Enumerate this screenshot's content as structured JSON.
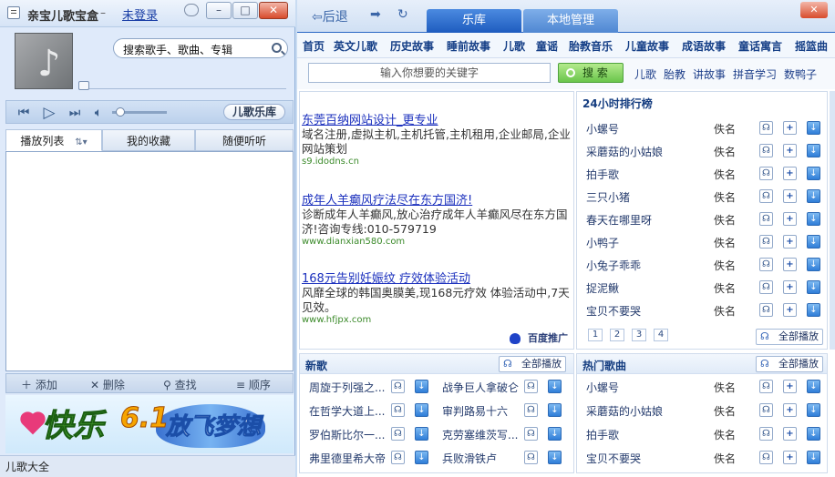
{
  "player": {
    "app_title": "亲宝儿歌宝盒",
    "title_sep": "–",
    "login_link": "未登录",
    "search_placeholder": "搜索歌手、歌曲、专辑",
    "library_button": "儿歌乐库",
    "tabs": [
      "播放列表",
      "我的收藏",
      "随便听听"
    ],
    "toolbar": [
      "添加",
      "删除",
      "查找",
      "顺序"
    ],
    "banner": {
      "text1": "快乐",
      "text2": "6.1",
      "text3": "放飞梦想"
    },
    "status": "儿歌大全"
  },
  "browser": {
    "back_label": "后退",
    "tabs": [
      "乐库",
      "本地管理"
    ],
    "categories": [
      "首页",
      "英文儿歌",
      "历史故事",
      "睡前故事",
      "儿歌",
      "童谣",
      "胎教音乐",
      "儿童故事",
      "成语故事",
      "童话寓言",
      "摇篮曲"
    ],
    "search": {
      "placeholder": "输入你想要的关键字",
      "button": "搜 索"
    },
    "quick_links": [
      "儿歌",
      "胎教",
      "讲故事",
      "拼音学习",
      "数鸭子"
    ],
    "ads": [
      {
        "title": "东莞百纳网站设计_更专业",
        "desc": "域名注册,虚拟主机,主机托管,主机租用,企业邮局,企业网站策划",
        "url": "s9.idodns.cn"
      },
      {
        "title": "成年人羊癫风疗法尽在东方国济!",
        "desc": "诊断成年人羊癫风,放心治疗成年人羊癫风尽在东方国济!咨询专线:010-579719",
        "url": "www.dianxian580.com"
      },
      {
        "title": "168元告别妊娠纹 疗效体验活动",
        "desc": "风靡全球的韩国奥膜美,现168元疗效 体验活动中,7天见效。",
        "url": "www.hfjpx.com"
      }
    ],
    "baidu_label": "百度推广",
    "top24": {
      "title": "24小时排行榜",
      "play_all": "全部播放",
      "songs": [
        "小螺号",
        "采蘑菇的小姑娘",
        "拍手歌",
        "三只小猪",
        "春天在哪里呀",
        "小鸭子",
        "小兔子乖乖",
        "捉泥鳅",
        "宝贝不要哭"
      ],
      "artist": "佚名",
      "pages": [
        "1",
        "2",
        "3",
        "4"
      ]
    },
    "new_songs": {
      "title": "新歌",
      "play_all": "全部播放",
      "left": [
        "周旋于列强之...",
        "在哲学大道上...",
        "罗伯斯比尔一...",
        "弗里德里希大帝"
      ],
      "right": [
        "战争巨人拿破仑",
        "审判路易十六",
        "克劳塞维茨写...",
        "兵败滑铁卢"
      ]
    },
    "hot_songs": {
      "title": "热门歌曲",
      "play_all": "全部播放",
      "songs": [
        "小螺号",
        "采蘑菇的小姑娘",
        "拍手歌",
        "宝贝不要哭"
      ],
      "artist": "佚名"
    }
  },
  "colors": {
    "accent_blue": "#1e5cbf",
    "link_blue": "#1a2fbd",
    "green_button": "#6ac54c"
  }
}
